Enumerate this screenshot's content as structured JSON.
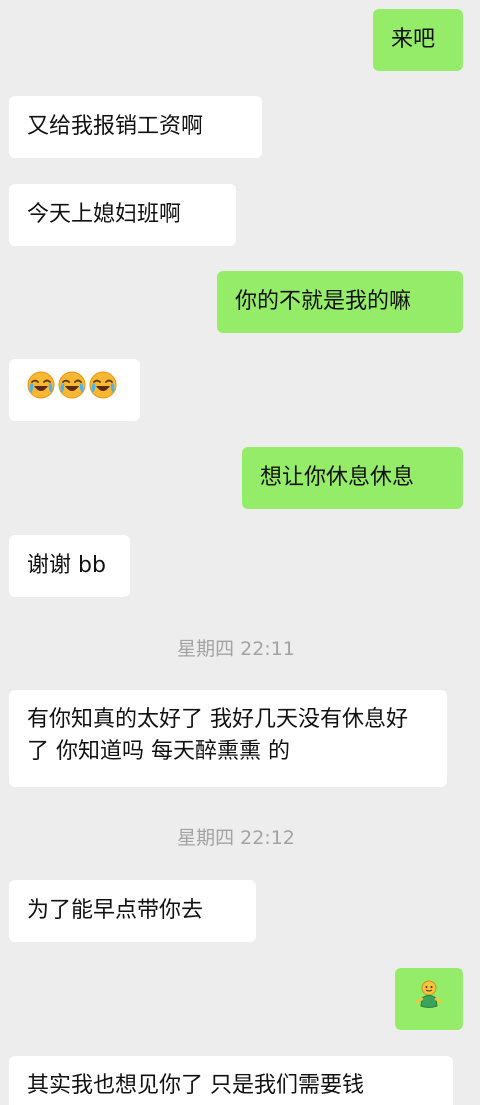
{
  "messages": [
    {
      "from": "me",
      "text": "来吧"
    },
    {
      "from": "them",
      "text": "又给我报销工资啊"
    },
    {
      "from": "them",
      "text": "今天上媳妇班啊"
    },
    {
      "from": "me",
      "text": "你的不就是我的嘛"
    },
    {
      "from": "them",
      "emoji": [
        "crying-laughing-face",
        "crying-laughing-face",
        "crying-laughing-face"
      ]
    },
    {
      "from": "me",
      "text": "想让你休息休息"
    },
    {
      "from": "them",
      "text": "谢谢 bb"
    },
    {
      "timestamp": "星期四 22:11"
    },
    {
      "from": "them",
      "text": "有你知真的太好了 我好几天没有休息好了 你知道吗 每天醉熏熏 的"
    },
    {
      "timestamp": "星期四 22:12"
    },
    {
      "from": "them",
      "text": "为了能早点带你去"
    },
    {
      "from": "me",
      "emoji": [
        "green-figure-sticker"
      ]
    },
    {
      "from": "them",
      "text": "其实我也想见你了 只是我们需要钱"
    }
  ],
  "colors": {
    "background": "#ededed",
    "incoming_bubble": "#ffffff",
    "outgoing_bubble": "#95ec69",
    "timestamp_text": "#a3a3a3"
  }
}
